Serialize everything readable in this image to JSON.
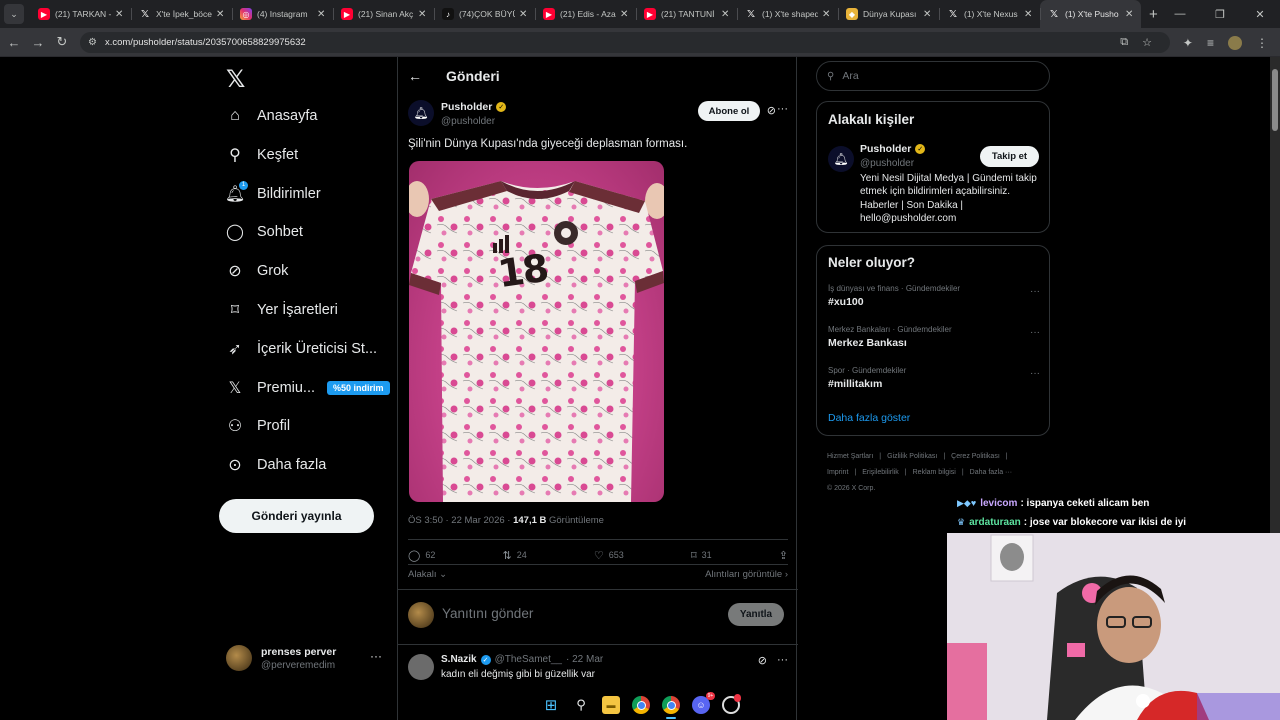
{
  "browser": {
    "tabs": [
      {
        "icon": "youtube-icon",
        "title": "(21) TARKAN -",
        "active": false
      },
      {
        "icon": "x-icon",
        "title": "X'te İpek_böce",
        "active": false
      },
      {
        "icon": "instagram-icon",
        "title": "(4) Instagram",
        "active": false
      },
      {
        "icon": "youtube-icon",
        "title": "(21) Sinan Akç",
        "active": false
      },
      {
        "icon": "tiktok-icon",
        "title": "(74)ÇOK BÜYÜ",
        "active": false
      },
      {
        "icon": "youtube-icon",
        "title": "(21) Edis - Aza",
        "active": false
      },
      {
        "icon": "youtube-icon",
        "title": "(21) TANTUNİ",
        "active": false
      },
      {
        "icon": "x-icon",
        "title": "(1) X'te shaped",
        "active": false
      },
      {
        "icon": "worldcup-icon",
        "title": "Dünya Kupası",
        "active": false
      },
      {
        "icon": "x-icon",
        "title": "(1) X'te Nexus",
        "active": false
      },
      {
        "icon": "x-icon",
        "title": "(1) X'te Pusho",
        "active": true
      }
    ],
    "url": "x.com/pusholder/status/2035700658829975632"
  },
  "nav": {
    "items": [
      {
        "icon": "home-icon",
        "label": "Anasayfa",
        "glyph": "⌂"
      },
      {
        "icon": "search-icon",
        "label": "Keşfet",
        "glyph": "⚲"
      },
      {
        "icon": "bell-icon",
        "label": "Bildirimler",
        "glyph": "🔔︎",
        "badge": "1"
      },
      {
        "icon": "chat-icon",
        "label": "Sohbet",
        "glyph": "◯"
      },
      {
        "icon": "grok-icon",
        "label": "Grok",
        "glyph": "⊘"
      },
      {
        "icon": "bookmark-icon",
        "label": "Yer İşaretleri",
        "glyph": "⌑"
      },
      {
        "icon": "rocket-icon",
        "label": "İçerik Üreticisi St...",
        "glyph": "➶"
      },
      {
        "icon": "x-premium-icon",
        "label": "Premiu...",
        "glyph": "𝕏",
        "promo": "%50 indirim"
      },
      {
        "icon": "profile-icon",
        "label": "Profil",
        "glyph": "⚇"
      },
      {
        "icon": "more-circle-icon",
        "label": "Daha fazla",
        "glyph": "⊙"
      }
    ],
    "post_button": "Gönderi yayınla",
    "me": {
      "name": "prenses perver",
      "handle": "@perveremedim"
    }
  },
  "main": {
    "header_title": "Gönderi",
    "post": {
      "author_name": "Pusholder",
      "author_handle": "@pusholder",
      "subscribe_label": "Abone ol",
      "text": "Şili'nin Dünya Kupası'nda giyeceği deplasman forması.",
      "time_date": "ÖS 3:50 · 22 Mar 2026 · ",
      "views_count": "147,1 B",
      "views_label": " Görüntüleme",
      "stats": {
        "replies": "62",
        "reposts": "24",
        "likes": "653",
        "bookmarks": "31"
      },
      "jersey_number": "18"
    },
    "sort_label": "Alakalı",
    "quotes_label": "Alıntıları görüntüle",
    "reply_placeholder": "Yanıtını gönder",
    "reply_button": "Yanıtla",
    "comment": {
      "name": "S.Nazik",
      "handle": "@TheSamet__",
      "date": "· 22 Mar",
      "text": "kadın eli değmiş gibi bi güzellik var"
    }
  },
  "right": {
    "search_placeholder": "Ara",
    "relevant": {
      "title": "Alakalı kişiler",
      "name": "Pusholder",
      "handle": "@pusholder",
      "follow_label": "Takip et",
      "bio": "Yeni Nesil Dijital Medya | Gündemi takip etmek için bildirimleri açabilirsiniz. Haberler | Son Dakika | hello@pusholder.com"
    },
    "trends": {
      "title": "Neler oluyor?",
      "items": [
        {
          "context": "İş dünyası ve finans · Gündemdekiler",
          "name": "#xu100"
        },
        {
          "context": "Merkez Bankaları · Gündemdekiler",
          "name": "Merkez Bankası"
        },
        {
          "context": "Spor · Gündemdekiler",
          "name": "#millitakım"
        }
      ],
      "show_more": "Daha fazla göster"
    },
    "footer": [
      "Hizmet Şartları",
      "|",
      "Gizlilik Politikası",
      "|",
      "Çerez Politikası",
      "|",
      "Imprint",
      "|",
      "Erişilebilirlik",
      "|",
      "Reklam bilgisi",
      "|",
      "Daha fazla ···",
      "© 2026 X Corp."
    ]
  },
  "stream": {
    "chat": [
      {
        "badges": "▶◆♥",
        "user": "levicom",
        "user_color": "#c9a8ff",
        "message": ": ispanya ceketi alicam ben"
      },
      {
        "badges": "♛",
        "user": "ardaturaan",
        "user_color": "#5de3a0",
        "message": ": jose var blokecore var ikisi de iyi"
      }
    ]
  },
  "colors": {
    "accent": "#1d9bf0",
    "background": "#000000",
    "verified_gold": "#e2b719"
  }
}
